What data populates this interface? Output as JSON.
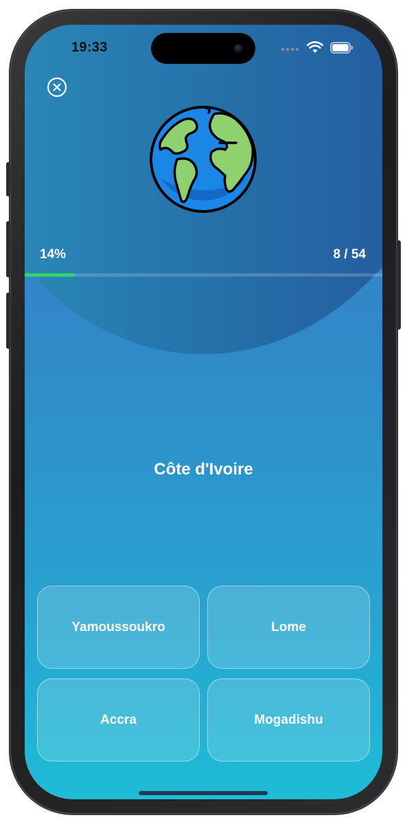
{
  "status_bar": {
    "time": "19:33",
    "icons": [
      "signal-icon",
      "wifi-icon",
      "battery-icon"
    ]
  },
  "quiz": {
    "close_icon": "close-circle-icon",
    "illustration": "globe-icon",
    "progress": {
      "percent_label": "14%",
      "fraction": 0.14,
      "count_label": "8 / 54"
    },
    "question": "Côte d'Ivoire",
    "answers": [
      {
        "label": "Yamoussoukro"
      },
      {
        "label": "Lome"
      },
      {
        "label": "Accra"
      },
      {
        "label": "Mogadishu"
      }
    ]
  },
  "colors": {
    "progress_fill": "#33d46a",
    "background_top": "#3d74c2",
    "background_bottom": "#1ebcd6"
  }
}
